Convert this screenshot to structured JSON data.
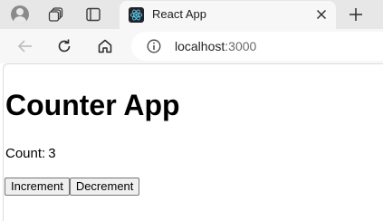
{
  "browser": {
    "tab": {
      "title": "React App",
      "active": true
    },
    "address": {
      "host": "localhost",
      "port": ":3000"
    },
    "icons": {
      "profile": "profile-avatar-icon",
      "workspaces": "workspaces-icon",
      "tab_actions": "tab-actions-icon",
      "favicon": "react-logo-icon",
      "close": "close-icon",
      "new_tab": "plus-icon",
      "back": "back-arrow-icon",
      "reload": "reload-icon",
      "home": "home-icon",
      "site_info": "info-icon"
    },
    "colors": {
      "tabstrip": "#e7e7e7",
      "toolbar": "#f7f7f7",
      "favicon_bg": "#20232a",
      "react": "#61dafb"
    }
  },
  "page": {
    "heading": "Counter App",
    "count_label": "Count:",
    "count_value": 3,
    "increment_label": "Increment",
    "decrement_label": "Decrement"
  }
}
